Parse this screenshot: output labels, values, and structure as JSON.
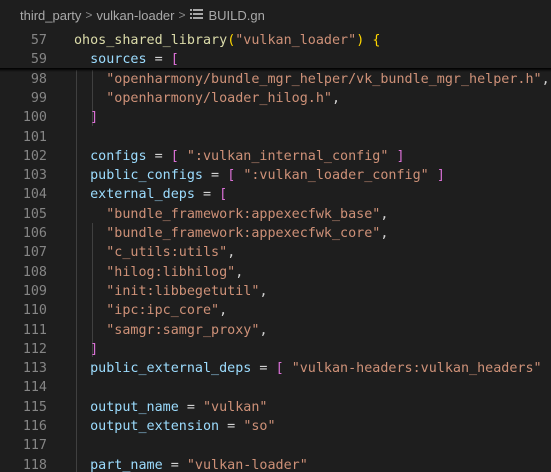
{
  "breadcrumb": {
    "items": [
      "third_party",
      "vulkan-loader",
      "BUILD.gn"
    ],
    "separator": ">",
    "file_icon": "list-lines-icon"
  },
  "colors": {
    "background": "#1e1e1e",
    "line_number": "#858585",
    "identifier": "#9cdcfe",
    "function": "#dcdcaa",
    "string": "#ce9178",
    "bracket_level_1": "#ffd700",
    "bracket_level_2": "#da70d6",
    "bracket_level_3": "#179fff"
  },
  "lines": [
    {
      "num": "57",
      "sticky": true,
      "tokens": [
        {
          "t": "ohos_shared_library",
          "c": "fn"
        },
        {
          "t": "(",
          "c": "br1"
        },
        {
          "t": "\"vulkan_loader\"",
          "c": "str"
        },
        {
          "t": ") ",
          "c": "br1"
        },
        {
          "t": "{",
          "c": "br1"
        }
      ]
    },
    {
      "num": "59",
      "sticky": true,
      "tokens": [
        {
          "t": "  "
        },
        {
          "t": "sources",
          "c": "ident"
        },
        {
          "t": " = ",
          "c": "op"
        },
        {
          "t": "[",
          "c": "br2"
        }
      ]
    },
    {
      "num": "98",
      "tokens": [
        {
          "t": "    "
        },
        {
          "t": "\"openharmony/bundle_mgr_helper/vk_bundle_mgr_helper.h\"",
          "c": "str"
        },
        {
          "t": ",",
          "c": "op"
        }
      ]
    },
    {
      "num": "99",
      "tokens": [
        {
          "t": "    "
        },
        {
          "t": "\"openharmony/loader_hilog.h\"",
          "c": "str"
        },
        {
          "t": ",",
          "c": "op"
        }
      ]
    },
    {
      "num": "100",
      "tokens": [
        {
          "t": "  "
        },
        {
          "t": "]",
          "c": "br2"
        }
      ]
    },
    {
      "num": "101",
      "tokens": []
    },
    {
      "num": "102",
      "tokens": [
        {
          "t": "  "
        },
        {
          "t": "configs",
          "c": "ident"
        },
        {
          "t": " = ",
          "c": "op"
        },
        {
          "t": "[",
          "c": "br2"
        },
        {
          "t": " "
        },
        {
          "t": "\":vulkan_internal_config\"",
          "c": "str"
        },
        {
          "t": " "
        },
        {
          "t": "]",
          "c": "br2"
        }
      ]
    },
    {
      "num": "103",
      "tokens": [
        {
          "t": "  "
        },
        {
          "t": "public_configs",
          "c": "ident"
        },
        {
          "t": " = ",
          "c": "op"
        },
        {
          "t": "[",
          "c": "br2"
        },
        {
          "t": " "
        },
        {
          "t": "\":vulkan_loader_config\"",
          "c": "str"
        },
        {
          "t": " "
        },
        {
          "t": "]",
          "c": "br2"
        }
      ]
    },
    {
      "num": "104",
      "tokens": [
        {
          "t": "  "
        },
        {
          "t": "external_deps",
          "c": "ident"
        },
        {
          "t": " = ",
          "c": "op"
        },
        {
          "t": "[",
          "c": "br2"
        }
      ]
    },
    {
      "num": "105",
      "tokens": [
        {
          "t": "    "
        },
        {
          "t": "\"bundle_framework:appexecfwk_base\"",
          "c": "str"
        },
        {
          "t": ",",
          "c": "op"
        }
      ]
    },
    {
      "num": "106",
      "tokens": [
        {
          "t": "    "
        },
        {
          "t": "\"bundle_framework:appexecfwk_core\"",
          "c": "str"
        },
        {
          "t": ",",
          "c": "op"
        }
      ]
    },
    {
      "num": "107",
      "tokens": [
        {
          "t": "    "
        },
        {
          "t": "\"c_utils:utils\"",
          "c": "str"
        },
        {
          "t": ",",
          "c": "op"
        }
      ]
    },
    {
      "num": "108",
      "tokens": [
        {
          "t": "    "
        },
        {
          "t": "\"hilog:libhilog\"",
          "c": "str"
        },
        {
          "t": ",",
          "c": "op"
        }
      ]
    },
    {
      "num": "109",
      "tokens": [
        {
          "t": "    "
        },
        {
          "t": "\"init:libbegetutil\"",
          "c": "str"
        },
        {
          "t": ",",
          "c": "op"
        }
      ]
    },
    {
      "num": "110",
      "tokens": [
        {
          "t": "    "
        },
        {
          "t": "\"ipc:ipc_core\"",
          "c": "str"
        },
        {
          "t": ",",
          "c": "op"
        }
      ]
    },
    {
      "num": "111",
      "tokens": [
        {
          "t": "    "
        },
        {
          "t": "\"samgr:samgr_proxy\"",
          "c": "str"
        },
        {
          "t": ",",
          "c": "op"
        }
      ]
    },
    {
      "num": "112",
      "tokens": [
        {
          "t": "  "
        },
        {
          "t": "]",
          "c": "br2"
        }
      ]
    },
    {
      "num": "113",
      "tokens": [
        {
          "t": "  "
        },
        {
          "t": "public_external_deps",
          "c": "ident"
        },
        {
          "t": " = ",
          "c": "op"
        },
        {
          "t": "[",
          "c": "br2"
        },
        {
          "t": " "
        },
        {
          "t": "\"vulkan-headers:vulkan_headers\"",
          "c": "str"
        },
        {
          "t": " "
        },
        {
          "t": "]",
          "c": "br2"
        }
      ]
    },
    {
      "num": "114",
      "tokens": []
    },
    {
      "num": "115",
      "tokens": [
        {
          "t": "  "
        },
        {
          "t": "output_name",
          "c": "ident"
        },
        {
          "t": " = ",
          "c": "op"
        },
        {
          "t": "\"vulkan\"",
          "c": "str"
        }
      ]
    },
    {
      "num": "116",
      "tokens": [
        {
          "t": "  "
        },
        {
          "t": "output_extension",
          "c": "ident"
        },
        {
          "t": " = ",
          "c": "op"
        },
        {
          "t": "\"so\"",
          "c": "str"
        }
      ]
    },
    {
      "num": "117",
      "tokens": []
    },
    {
      "num": "118",
      "tokens": [
        {
          "t": "  "
        },
        {
          "t": "part_name",
          "c": "ident"
        },
        {
          "t": " = ",
          "c": "op"
        },
        {
          "t": "\"vulkan-loader\"",
          "c": "str"
        }
      ]
    }
  ]
}
